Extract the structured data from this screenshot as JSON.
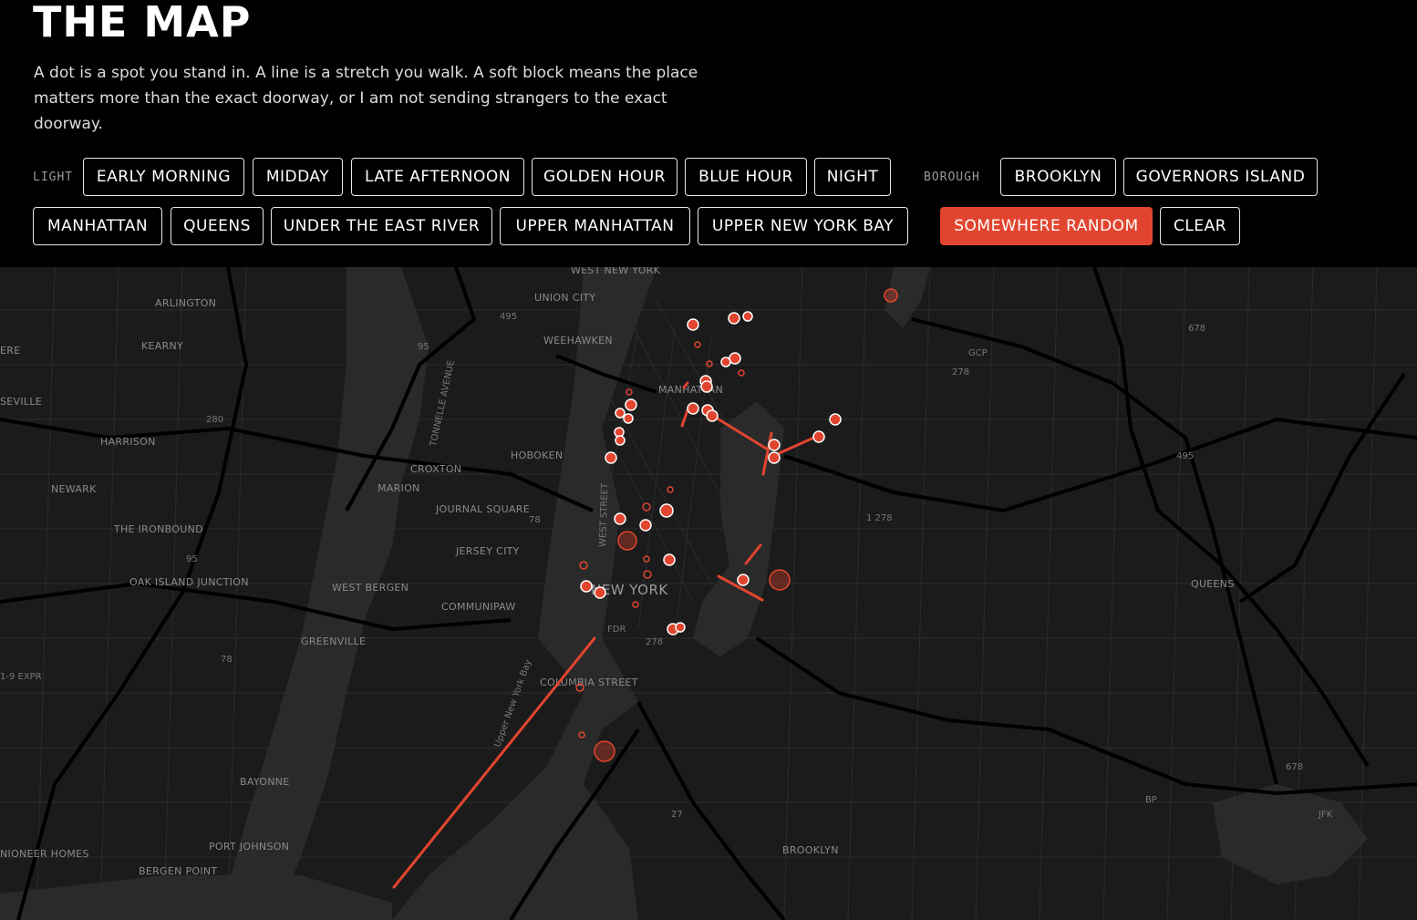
{
  "header": {
    "title": "THE MAP",
    "intro": "A dot is a spot you stand in. A line is a stretch you walk. A soft block means the place matters more than the exact doorway, or I am not sending strangers to the exact doorway."
  },
  "filters": {
    "light_label": "LIGHT",
    "light": [
      "EARLY MORNING",
      "MIDDAY",
      "LATE AFTERNOON",
      "GOLDEN HOUR",
      "BLUE HOUR",
      "NIGHT"
    ],
    "borough_label": "BOROUGH",
    "borough": [
      "BROOKLYN",
      "GOVERNORS ISLAND",
      "MANHATTAN",
      "QUEENS",
      "UNDER THE EAST RIVER",
      "UPPER MANHATTAN",
      "UPPER NEW YORK BAY"
    ],
    "random": "SOMEWHERE RANDOM",
    "clear": "CLEAR"
  },
  "colors": {
    "accent": "#e2452f",
    "map_bg": "#1b1b1b",
    "water": "#2a2a2a",
    "road": "#000000"
  },
  "map": {
    "place_labels": [
      "WEST NEW YORK",
      "UNION CITY",
      "ARLINGTON",
      "KEARNY",
      "WEEHAWKEN",
      "HARRISON",
      "HOBOKEN",
      "CROXTON",
      "MARION",
      "NEWARK",
      "JOURNAL SQUARE",
      "JERSEY CITY",
      "THE IRONBOUND",
      "OAK ISLAND JUNCTION",
      "WEST BERGEN",
      "COMMUNIPAW",
      "GREENVILLE",
      "COLUMBIA STREET",
      "BAYONNE",
      "PORT JOHNSON",
      "BERGEN POINT",
      "BROOKLYN",
      "QUEENS",
      "NEW YORK",
      "MANHATTAN",
      "NIONEER HOMES",
      "SEVILLE",
      "ERE"
    ],
    "road_shields": [
      "495",
      "95",
      "280",
      "278",
      "78",
      "1 278",
      "495",
      "678",
      "GCP",
      "FDR",
      "278",
      "27",
      "BP",
      "JFK",
      "678",
      "95",
      "78",
      "1-9 EXPR"
    ],
    "street_labels": [
      "TONNELLE AVENUE",
      "WEST STREET",
      "Upper New York Bay"
    ]
  }
}
